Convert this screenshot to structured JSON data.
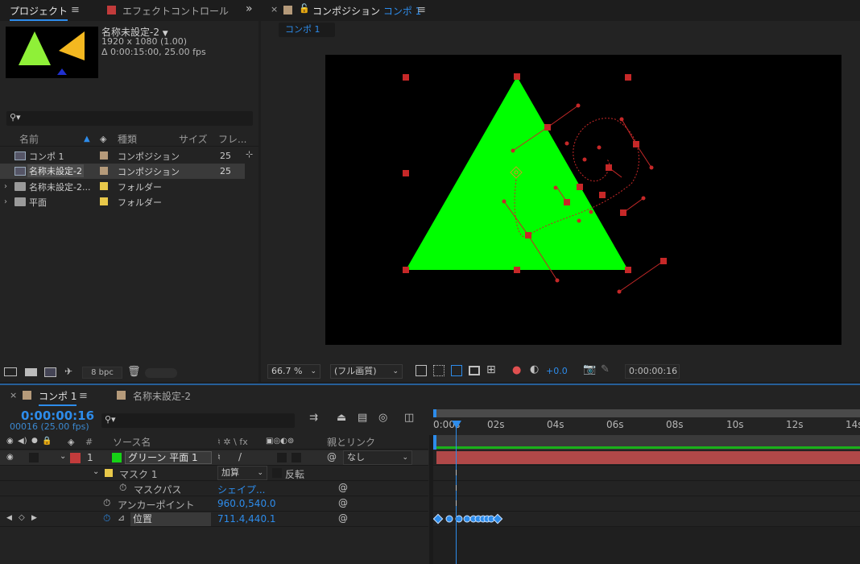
{
  "project": {
    "tab_label": "プロジェクト",
    "effect_tab_label": "エフェクトコントロール",
    "selected_name": "名称未設定-2",
    "resolution": "1920 x 1080 (1.00)",
    "duration": "Δ 0:00:15:00, 25.00 fps",
    "columns": {
      "name": "名前",
      "type": "種類",
      "size": "サイズ",
      "frame": "フレ..."
    },
    "items": [
      {
        "name": "コンポ 1",
        "type": "コンポジション",
        "fps": "25",
        "swatch": "#b59a7a"
      },
      {
        "name": "名称未設定-2",
        "type": "コンポジション",
        "fps": "25",
        "swatch": "#b59a7a"
      },
      {
        "name": "名称未設定-2...",
        "type": "フォルダー",
        "fps": "",
        "swatch": "#e8c84a"
      },
      {
        "name": "平面",
        "type": "フォルダー",
        "fps": "",
        "swatch": "#e8c84a"
      }
    ],
    "bpc": "8 bpc"
  },
  "composition": {
    "tab_prefix": "コンポジション",
    "tab_name": "コンポ 1",
    "breadcrumb": "コンポ 1",
    "zoom": "66.7 %",
    "quality": "(フル画質)",
    "exposure": "+0.0",
    "timecode": "0:00:00:16"
  },
  "timeline": {
    "tab_name": "コンポ 1",
    "tab2_name": "名称未設定-2",
    "timecode": "0:00:00:16",
    "frame_info": "00016 (25.00 fps)",
    "col_source": "ソース名",
    "col_parent": "親とリンク",
    "col_switch_label": "♮ ✲ \\ fx",
    "ruler": [
      "0:00s",
      "02s",
      "04s",
      "06s",
      "08s",
      "10s",
      "12s",
      "14s"
    ],
    "layer": {
      "num": "1",
      "name": "グリーン 平面 1",
      "parent": "なし",
      "color": "#16d316"
    },
    "mask": {
      "name": "マスク 1",
      "mode": "加算",
      "invert": "反転"
    },
    "props": [
      {
        "name": "マスクパス",
        "value": "シェイプ..."
      },
      {
        "name": "アンカーポイント",
        "value": "960.0,540.0"
      },
      {
        "name": "位置",
        "value": "711.4,440.1"
      }
    ]
  },
  "colors": {
    "accent": "#2d8ceb",
    "layer_bar": "#b04848",
    "handle": "#c62828",
    "triangle": "#00ff00"
  }
}
